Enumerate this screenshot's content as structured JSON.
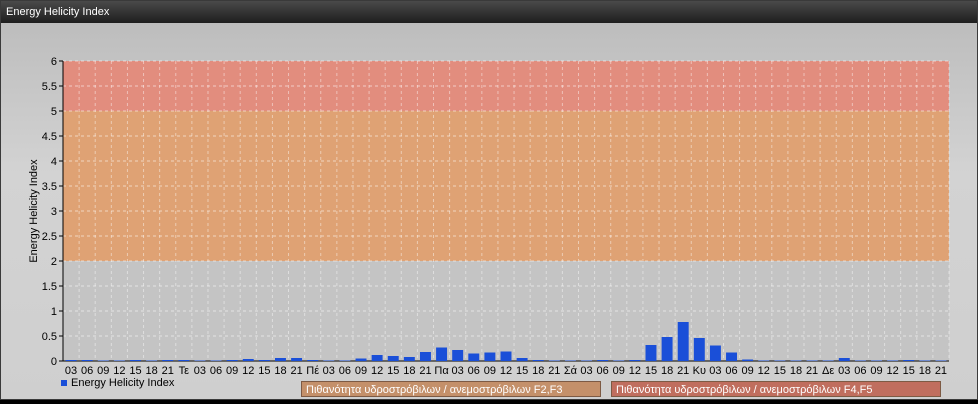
{
  "window": {
    "title": "Energy Helicity Index"
  },
  "legend": {
    "label": "Energy Helicity Index",
    "color": "#1a4fd8"
  },
  "bands": [
    {
      "label": "Πιθανότητα υδροστρόβιλων / ανεμοστρόβιλων F2,F3",
      "from": 2,
      "to": 5,
      "color": "#e0a070",
      "tag_color": "#c4906a"
    },
    {
      "label": "Πιθανότητα υδροστρόβιλων / ανεμοστρόβιλων F4,F5",
      "from": 5,
      "to": 6,
      "color": "#e48a7a",
      "tag_color": "#c06e5e"
    }
  ],
  "chart_data": {
    "type": "bar",
    "ylabel": "Energy Helicity Index",
    "ylim": [
      0,
      6
    ],
    "yticks": [
      "0",
      "0.5",
      "1",
      "1.5",
      "2",
      "2.5",
      "3",
      "3.5",
      "4",
      "4.5",
      "5",
      "5.5",
      "6"
    ],
    "grid": true,
    "categories": [
      "03",
      "06",
      "09",
      "12",
      "15",
      "18",
      "21",
      "Τε",
      "03",
      "06",
      "09",
      "12",
      "15",
      "18",
      "21",
      "Πέ",
      "03",
      "06",
      "09",
      "12",
      "15",
      "18",
      "21",
      "Πα",
      "03",
      "06",
      "09",
      "12",
      "15",
      "18",
      "21",
      "Σά",
      "03",
      "06",
      "09",
      "12",
      "15",
      "18",
      "21",
      "Κυ",
      "03",
      "06",
      "09",
      "12",
      "15",
      "18",
      "21",
      "Δε",
      "03",
      "06",
      "09",
      "12",
      "15",
      "18",
      "21"
    ],
    "series": [
      {
        "name": "Energy Helicity Index",
        "color": "#1a4fd8",
        "values": [
          0.02,
          0.02,
          0.01,
          0.01,
          0.02,
          0.01,
          0.02,
          0.02,
          0.01,
          0.01,
          0.02,
          0.04,
          0.02,
          0.06,
          0.06,
          0.02,
          0.01,
          0.01,
          0.05,
          0.12,
          0.1,
          0.08,
          0.18,
          0.27,
          0.22,
          0.15,
          0.17,
          0.19,
          0.06,
          0.02,
          0.01,
          0.01,
          0.01,
          0.02,
          0.01,
          0.02,
          0.32,
          0.48,
          0.78,
          0.46,
          0.31,
          0.17,
          0.03,
          0.01,
          0.01,
          0.01,
          0.01,
          0.01,
          0.06,
          0.01,
          0.01,
          0.01,
          0.02,
          0.01,
          0.01
        ]
      }
    ]
  }
}
